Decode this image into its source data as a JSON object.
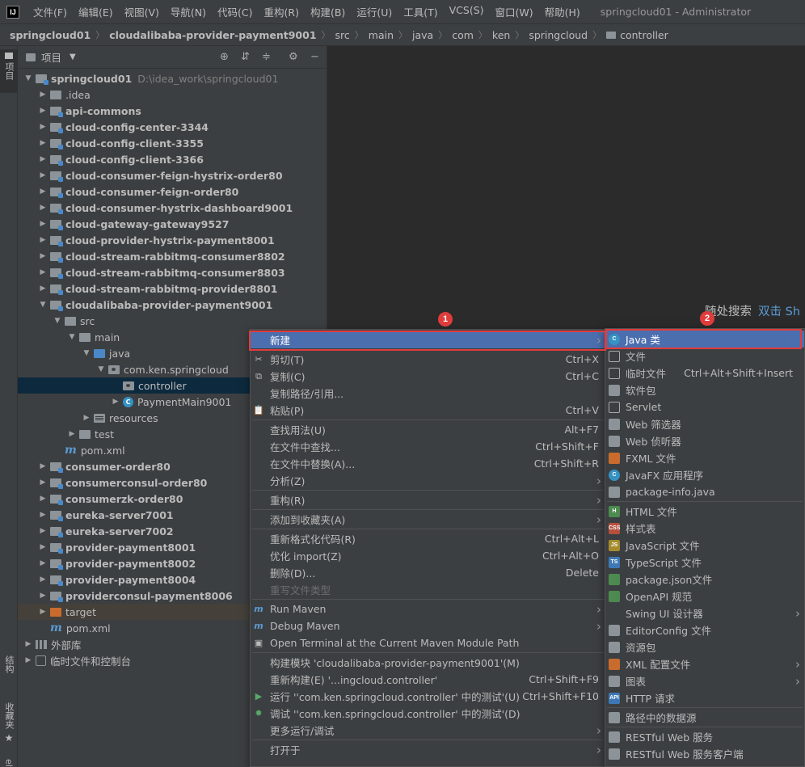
{
  "menubar": {
    "logo": "IJ",
    "items": [
      "文件(F)",
      "编辑(E)",
      "视图(V)",
      "导航(N)",
      "代码(C)",
      "重构(R)",
      "构建(B)",
      "运行(U)",
      "工具(T)",
      "VCS(S)",
      "窗口(W)",
      "帮助(H)"
    ],
    "title": "springcloud01 - Administrator"
  },
  "breadcrumb": [
    "springcloud01",
    "cloudalibaba-provider-payment9001",
    "src",
    "main",
    "java",
    "com",
    "ken",
    "springcloud",
    "controller"
  ],
  "stripe": {
    "project": "项目",
    "structure": "结构",
    "favorites": "收藏夹",
    "bottom": "el"
  },
  "panel": {
    "title": "项目",
    "dropdown_icon": "caret-down"
  },
  "tree": [
    {
      "label": "springcloud01",
      "hint": "D:\\idea_work\\springcloud01",
      "bold": true,
      "level": 0,
      "arrow": "down",
      "icon": "mod"
    },
    {
      "label": ".idea",
      "level": 1,
      "arrow": "right",
      "icon": "gray"
    },
    {
      "label": "api-commons",
      "bold": true,
      "level": 1,
      "arrow": "right",
      "icon": "mod"
    },
    {
      "label": "cloud-config-center-3344",
      "bold": true,
      "level": 1,
      "arrow": "right",
      "icon": "mod"
    },
    {
      "label": "cloud-config-client-3355",
      "bold": true,
      "level": 1,
      "arrow": "right",
      "icon": "mod"
    },
    {
      "label": "cloud-config-client-3366",
      "bold": true,
      "level": 1,
      "arrow": "right",
      "icon": "mod"
    },
    {
      "label": "cloud-consumer-feign-hystrix-order80",
      "bold": true,
      "level": 1,
      "arrow": "right",
      "icon": "mod"
    },
    {
      "label": "cloud-consumer-feign-order80",
      "bold": true,
      "level": 1,
      "arrow": "right",
      "icon": "mod"
    },
    {
      "label": "cloud-consumer-hystrix-dashboard9001",
      "bold": true,
      "level": 1,
      "arrow": "right",
      "icon": "mod"
    },
    {
      "label": "cloud-gateway-gateway9527",
      "bold": true,
      "level": 1,
      "arrow": "right",
      "icon": "mod"
    },
    {
      "label": "cloud-provider-hystrix-payment8001",
      "bold": true,
      "level": 1,
      "arrow": "right",
      "icon": "mod"
    },
    {
      "label": "cloud-stream-rabbitmq-consumer8802",
      "bold": true,
      "level": 1,
      "arrow": "right",
      "icon": "mod"
    },
    {
      "label": "cloud-stream-rabbitmq-consumer8803",
      "bold": true,
      "level": 1,
      "arrow": "right",
      "icon": "mod"
    },
    {
      "label": "cloud-stream-rabbitmq-provider8801",
      "bold": true,
      "level": 1,
      "arrow": "right",
      "icon": "mod"
    },
    {
      "label": "cloudalibaba-provider-payment9001",
      "bold": true,
      "level": 1,
      "arrow": "down",
      "icon": "mod"
    },
    {
      "label": "src",
      "level": 2,
      "arrow": "down",
      "icon": "gray"
    },
    {
      "label": "main",
      "level": 3,
      "arrow": "down",
      "icon": "gray"
    },
    {
      "label": "java",
      "level": 4,
      "arrow": "down",
      "icon": "blue"
    },
    {
      "label": "com.ken.springcloud",
      "level": 5,
      "arrow": "down",
      "icon": "pkg"
    },
    {
      "label": "controller",
      "level": 6,
      "arrow": "none",
      "icon": "pkg",
      "selected": true
    },
    {
      "label": "PaymentMain9001",
      "level": 6,
      "arrow": "right",
      "icon": "class"
    },
    {
      "label": "resources",
      "level": 4,
      "arrow": "right",
      "icon": "res"
    },
    {
      "label": "test",
      "level": 3,
      "arrow": "right",
      "icon": "gray"
    },
    {
      "label": "pom.xml",
      "level": 2,
      "arrow": "none",
      "icon": "maven"
    },
    {
      "label": "consumer-order80",
      "bold": true,
      "level": 1,
      "arrow": "right",
      "icon": "mod"
    },
    {
      "label": "consumerconsul-order80",
      "bold": true,
      "level": 1,
      "arrow": "right",
      "icon": "mod"
    },
    {
      "label": "consumerzk-order80",
      "bold": true,
      "level": 1,
      "arrow": "right",
      "icon": "mod"
    },
    {
      "label": "eureka-server7001",
      "bold": true,
      "level": 1,
      "arrow": "right",
      "icon": "mod"
    },
    {
      "label": "eureka-server7002",
      "bold": true,
      "level": 1,
      "arrow": "right",
      "icon": "mod"
    },
    {
      "label": "provider-payment8001",
      "bold": true,
      "level": 1,
      "arrow": "right",
      "icon": "mod"
    },
    {
      "label": "provider-payment8002",
      "bold": true,
      "level": 1,
      "arrow": "right",
      "icon": "mod"
    },
    {
      "label": "provider-payment8004",
      "bold": true,
      "level": 1,
      "arrow": "right",
      "icon": "mod"
    },
    {
      "label": "providerconsul-payment8006",
      "bold": true,
      "level": 1,
      "arrow": "right",
      "icon": "mod"
    },
    {
      "label": "target",
      "level": 1,
      "arrow": "right",
      "icon": "orange",
      "target": true
    },
    {
      "label": "pom.xml",
      "level": 1,
      "arrow": "none",
      "icon": "maven"
    },
    {
      "label": "外部库",
      "level": 0,
      "arrow": "right",
      "icon": "extlib"
    },
    {
      "label": "临时文件和控制台",
      "level": 0,
      "arrow": "right",
      "icon": "scratch"
    }
  ],
  "editor": {
    "search_hint": "随处搜索",
    "search_key": "双击 Sh"
  },
  "context_menu": [
    {
      "label": "新建",
      "arrow": true,
      "active": true
    },
    {
      "sep": true
    },
    {
      "label": "剪切(T)",
      "key": "Ctrl+X",
      "icon": "✂"
    },
    {
      "label": "复制(C)",
      "key": "Ctrl+C",
      "icon": "⧉"
    },
    {
      "label": "复制路径/引用..."
    },
    {
      "label": "粘贴(P)",
      "key": "Ctrl+V",
      "icon": "📋"
    },
    {
      "sep": true
    },
    {
      "label": "查找用法(U)",
      "key": "Alt+F7"
    },
    {
      "label": "在文件中查找...",
      "key": "Ctrl+Shift+F"
    },
    {
      "label": "在文件中替换(A)...",
      "key": "Ctrl+Shift+R"
    },
    {
      "label": "分析(Z)",
      "arrow": true
    },
    {
      "sep": true
    },
    {
      "label": "重构(R)",
      "arrow": true
    },
    {
      "sep": true
    },
    {
      "label": "添加到收藏夹(A)",
      "arrow": true
    },
    {
      "sep": true
    },
    {
      "label": "重新格式化代码(R)",
      "key": "Ctrl+Alt+L"
    },
    {
      "label": "优化 import(Z)",
      "key": "Ctrl+Alt+O"
    },
    {
      "label": "删除(D)...",
      "key": "Delete"
    },
    {
      "label": "重写文件类型",
      "disabled": true
    },
    {
      "sep": true
    },
    {
      "label": "Run Maven",
      "arrow": true,
      "icon": "m"
    },
    {
      "label": "Debug Maven",
      "arrow": true,
      "icon": "m"
    },
    {
      "label": "Open Terminal at the Current Maven Module Path",
      "icon": "▣"
    },
    {
      "sep": true
    },
    {
      "label": "构建模块 'cloudalibaba-provider-payment9001'(M)"
    },
    {
      "label": "重新构建(E) '...ingcloud.controller'",
      "key": "Ctrl+Shift+F9"
    },
    {
      "label": "运行 ''com.ken.springcloud.controller' 中的测试'(U)",
      "key": "Ctrl+Shift+F10",
      "icon": "▶"
    },
    {
      "label": "调试 ''com.ken.springcloud.controller' 中的测试'(D)",
      "icon": "✹"
    },
    {
      "label": "更多运行/调试",
      "arrow": true
    },
    {
      "sep": true
    },
    {
      "label": "打开于",
      "arrow": true
    }
  ],
  "sub_menu": [
    {
      "label": "Java 类",
      "icon": "java",
      "glyph": "C",
      "active": true
    },
    {
      "label": "文件",
      "icon": "file",
      "glyph": ""
    },
    {
      "label": "临时文件",
      "key": "Ctrl+Alt+Shift+Insert",
      "icon": "file",
      "glyph": ""
    },
    {
      "label": "软件包",
      "icon": "gray",
      "glyph": ""
    },
    {
      "label": "Servlet",
      "icon": "file",
      "glyph": ""
    },
    {
      "label": "Web 筛选器",
      "icon": "gray",
      "glyph": ""
    },
    {
      "label": "Web 侦听器",
      "icon": "gray",
      "glyph": ""
    },
    {
      "label": "FXML 文件",
      "icon": "orange",
      "glyph": ""
    },
    {
      "label": "JavaFX 应用程序",
      "icon": "java",
      "glyph": "C"
    },
    {
      "label": "package-info.java",
      "icon": "gray",
      "glyph": ""
    },
    {
      "sep": true
    },
    {
      "label": "HTML 文件",
      "icon": "green",
      "glyph": "H"
    },
    {
      "label": "样式表",
      "icon": "red",
      "glyph": "CSS"
    },
    {
      "label": "JavaScript 文件",
      "icon": "yellow",
      "glyph": "JS"
    },
    {
      "label": "TypeScript 文件",
      "icon": "blue",
      "glyph": "TS"
    },
    {
      "label": "package.json文件",
      "icon": "green",
      "glyph": ""
    },
    {
      "label": "OpenAPI 规范",
      "icon": "green",
      "glyph": ""
    },
    {
      "label": "Swing UI 设计器",
      "arrow": true
    },
    {
      "label": "EditorConfig 文件",
      "icon": "gray",
      "glyph": ""
    },
    {
      "label": "资源包",
      "icon": "gray",
      "glyph": ""
    },
    {
      "label": "XML 配置文件",
      "arrow": true,
      "icon": "orange",
      "glyph": ""
    },
    {
      "label": "图表",
      "arrow": true,
      "icon": "gray",
      "glyph": ""
    },
    {
      "label": "HTTP 请求",
      "icon": "blue",
      "glyph": "API"
    },
    {
      "sep": true
    },
    {
      "label": "路径中的数据源",
      "icon": "gray",
      "glyph": ""
    },
    {
      "sep": true
    },
    {
      "label": "RESTful Web 服务",
      "icon": "gray",
      "glyph": ""
    },
    {
      "label": "RESTful Web 服务客户端",
      "icon": "gray",
      "glyph": ""
    }
  ],
  "annotations": {
    "badge1": "1",
    "badge2": "2"
  },
  "colors": {
    "accent": "#4b6eaf",
    "highlight_border": "#e03c3c",
    "selected_row": "#0d293e",
    "link": "#5a9bd3"
  }
}
